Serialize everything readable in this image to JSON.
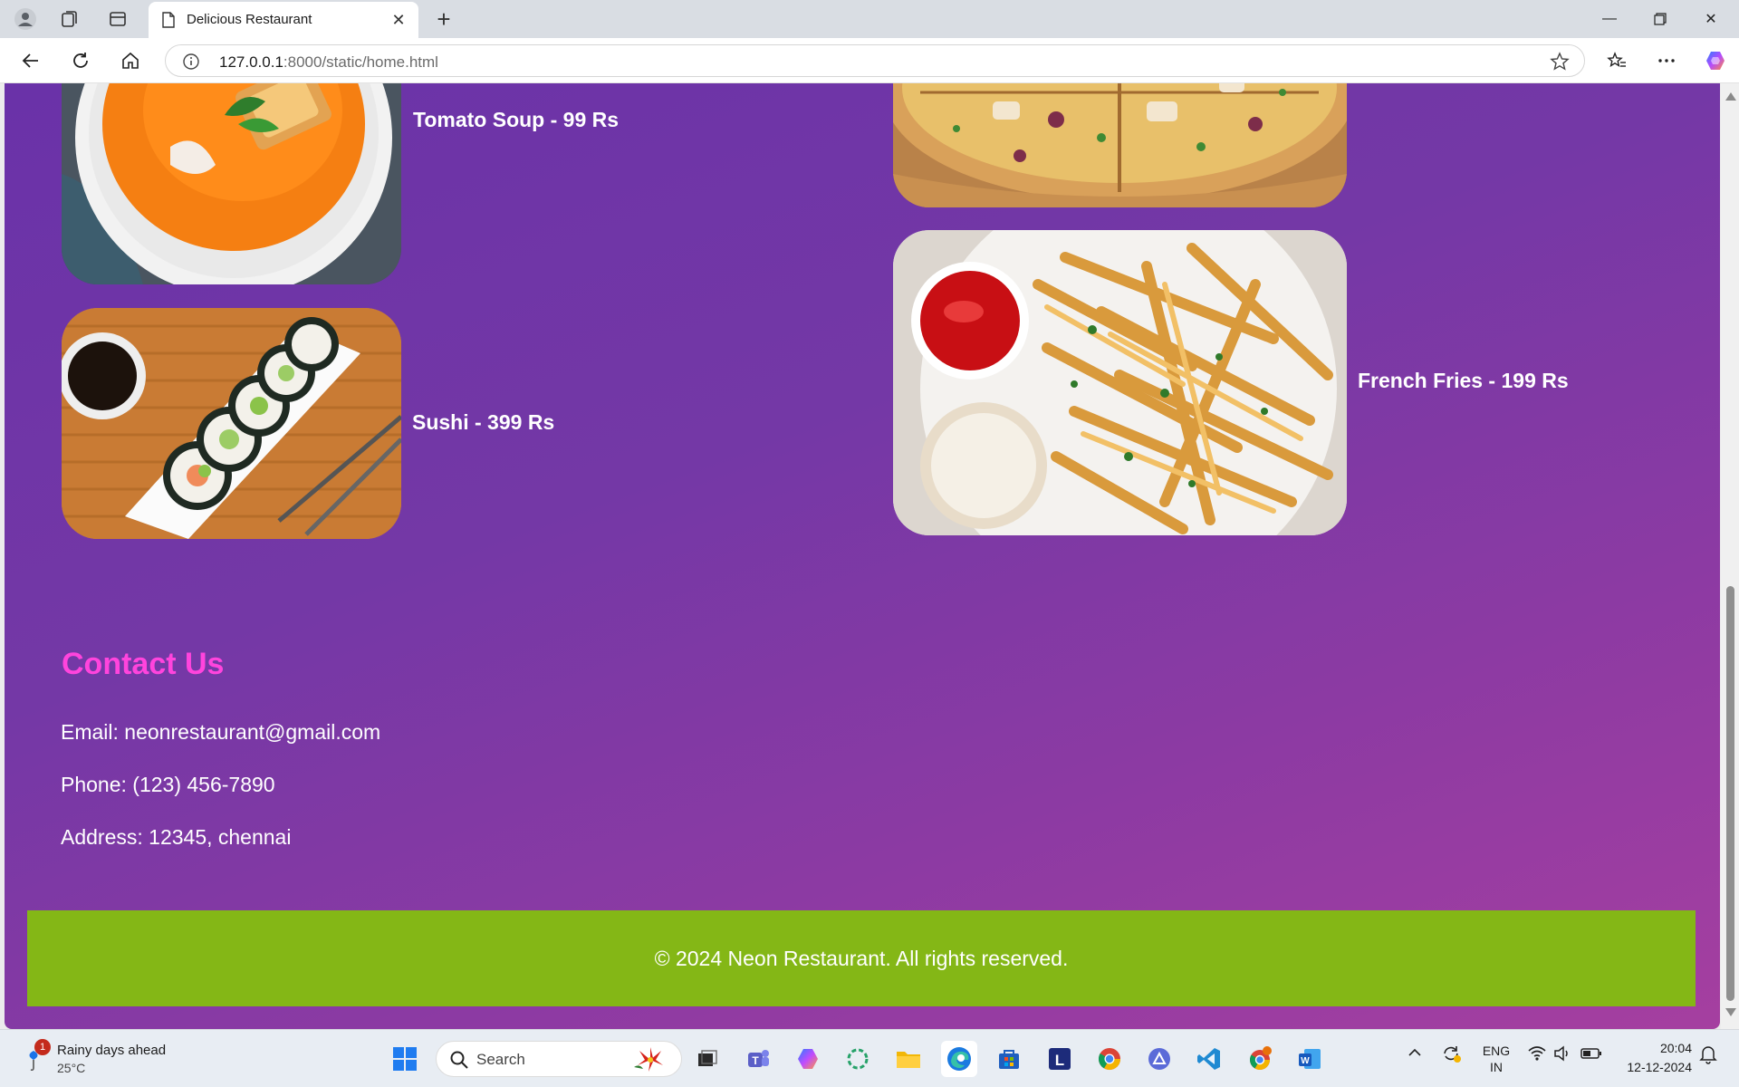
{
  "browser": {
    "tab_title": "Delicious Restaurant",
    "url_host": "127.0.0.1",
    "url_path": ":8000/static/home.html"
  },
  "menu": {
    "items": [
      {
        "label": "Tomato Soup - 99 Rs",
        "image": "tomato-soup-image"
      },
      {
        "label": "Sushi - 399 Rs",
        "image": "sushi-image"
      },
      {
        "label": "",
        "image": "pizza-image"
      },
      {
        "label": "French Fries - 199 Rs",
        "image": "french-fries-image"
      }
    ]
  },
  "contact": {
    "title": "Contact Us",
    "email": "Email: neonrestaurant@gmail.com",
    "phone": "Phone: (123) 456-7890",
    "address": "Address: 12345, chennai"
  },
  "footer": {
    "text": "© 2024 Neon Restaurant. All rights reserved."
  },
  "taskbar": {
    "weather_badge": "1",
    "weather_main": "Rainy days ahead",
    "weather_temp": "25°C",
    "search_label": "Search",
    "lang_top": "ENG",
    "lang_bottom": "IN",
    "time": "20:04",
    "date": "12-12-2024"
  },
  "colors": {
    "page_gradient_start": "#6a32a8",
    "page_gradient_end": "#a53fa0",
    "contact_title": "#ff44dd",
    "footer_bg": "#84b716"
  }
}
